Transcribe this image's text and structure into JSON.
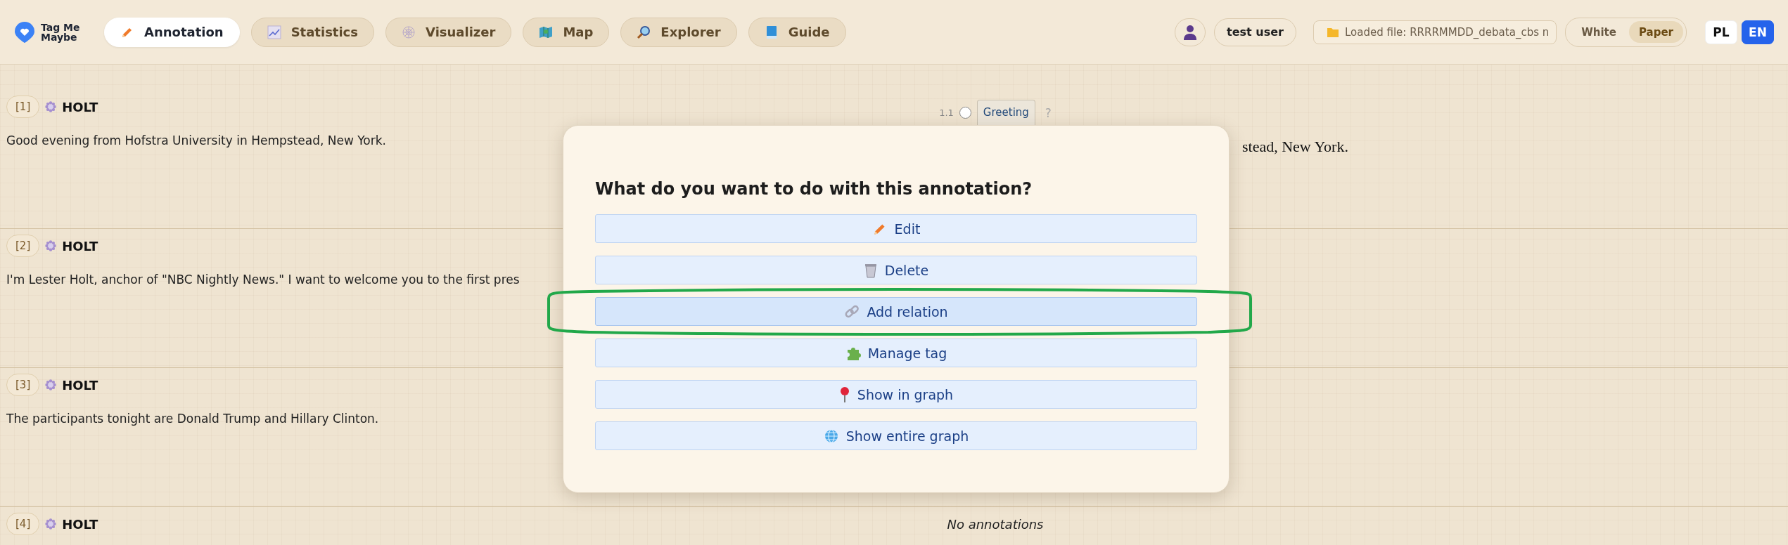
{
  "app": {
    "name": "Tag Me Maybe"
  },
  "nav": {
    "tabs": [
      {
        "label": "Annotation",
        "selected": true
      },
      {
        "label": "Statistics",
        "selected": false
      },
      {
        "label": "Visualizer",
        "selected": false
      },
      {
        "label": "Map",
        "selected": false
      },
      {
        "label": "Explorer",
        "selected": false
      },
      {
        "label": "Guide",
        "selected": false
      }
    ]
  },
  "user": {
    "name": "test user"
  },
  "file": {
    "label": "Loaded file: RRRRMMDD_debata_cbs n"
  },
  "theme": [
    {
      "label": "White",
      "selected": false
    },
    {
      "label": "Paper",
      "selected": true
    }
  ],
  "languages": [
    {
      "label": "PL",
      "selected": false
    },
    {
      "label": "EN",
      "selected": true
    }
  ],
  "utterances": [
    {
      "index": "[1]",
      "speaker": "HOLT",
      "text": "Good evening from Hofstra University in Hempstead, New York.",
      "annotations": [
        {
          "number": "1.1",
          "tag": "Greeting",
          "help": "?",
          "selected": false
        }
      ],
      "translation": "stead, New York."
    },
    {
      "index": "[2]",
      "speaker": "HOLT",
      "text": "I'm Lester Holt, anchor of \"NBC Nightly News.\" I want to welcome you to the first pres"
    },
    {
      "index": "[3]",
      "speaker": "HOLT",
      "text": "The participants tonight are Donald Trump and Hillary Clinton."
    },
    {
      "index": "[4]",
      "speaker": "HOLT",
      "empty_note": "No annotations"
    }
  ],
  "modal": {
    "title": "What do you want to do with this annotation?",
    "actions": [
      {
        "label": "Edit",
        "highlighted": false,
        "circled": false
      },
      {
        "label": "Delete",
        "highlighted": false,
        "circled": false
      },
      {
        "label": "Add relation",
        "highlighted": true,
        "circled": true
      },
      {
        "label": "Manage tag",
        "highlighted": false,
        "circled": false
      },
      {
        "label": "Show in graph",
        "highlighted": false,
        "circled": false
      },
      {
        "label": "Show entire graph",
        "highlighted": false,
        "circled": false
      }
    ]
  }
}
